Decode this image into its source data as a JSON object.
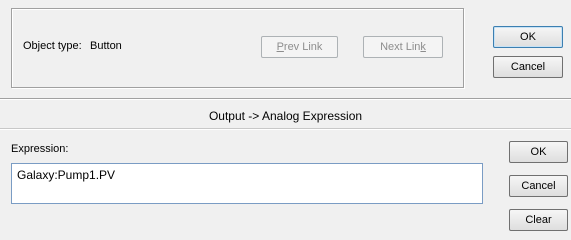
{
  "top_dialog": {
    "object_type_label": "Object type:",
    "object_type_value": "Button",
    "prev_link_label_prefix": "",
    "prev_link_label_underlined": "P",
    "prev_link_label_rest": "rev Link",
    "next_link_label_prefix": "Next Lin",
    "next_link_label_underlined": "k",
    "next_link_label_rest": "",
    "ok_label": "OK",
    "cancel_label": "Cancel"
  },
  "expression_dialog": {
    "title": "Output -> Analog Expression",
    "expression_label": "Expression:",
    "expression_value": "Galaxy:Pump1.PV",
    "ok_label": "OK",
    "cancel_label": "Cancel",
    "clear_label": "Clear"
  }
}
